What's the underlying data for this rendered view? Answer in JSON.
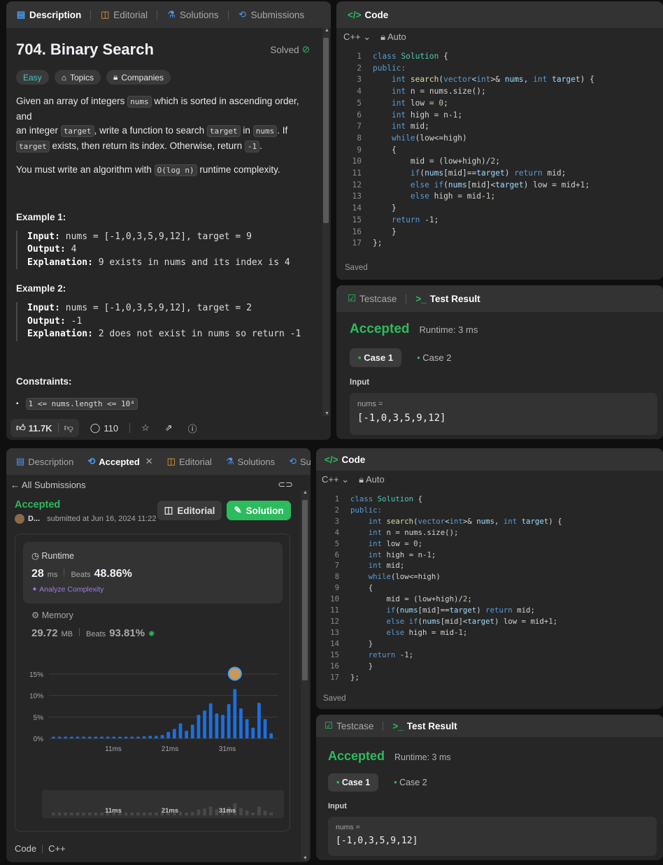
{
  "p1": {
    "tabs": [
      "Description",
      "Editorial",
      "Solutions",
      "Submissions"
    ],
    "title": "704. Binary Search",
    "solved": "Solved",
    "tags": [
      "Easy",
      "Topics",
      "Companies"
    ],
    "desc": {
      "t1": "Given an array of integers",
      "c1": "nums",
      "t2": "which is sorted in ascending order, and",
      "t3": "an integer",
      "c2": "target",
      "t4": ", write a function to search",
      "c3": "target",
      "t5": "in",
      "c4": "nums",
      "t6": ". If",
      "c5": "target",
      "t7": "exists, then return its index. Otherwise, return",
      "c6": "-1",
      "t8": ".",
      "t9": "You must write an algorithm with",
      "c7": "O(log n)",
      "t10": "runtime complexity."
    },
    "ex1": {
      "h": "Example 1:",
      "in_l": "Input:",
      "in_v": "nums = [-1,0,3,5,9,12], target = 9",
      "out_l": "Output:",
      "out_v": "4",
      "ex_l": "Explanation:",
      "ex_v": "9 exists in nums and its index is 4"
    },
    "ex2": {
      "h": "Example 2:",
      "in_l": "Input:",
      "in_v": "nums = [-1,0,3,5,9,12], target = 2",
      "out_l": "Output:",
      "out_v": "-1",
      "ex_l": "Explanation:",
      "ex_v": "2 does not exist in nums so return -1"
    },
    "constraints_h": "Constraints:",
    "constraint1": "1 <= nums.length <= 10⁴",
    "likes": "11.7K",
    "comments": "110"
  },
  "code_panel": {
    "title": "Code",
    "lang": "C++",
    "mode": "Auto",
    "saved": "Saved"
  },
  "result": {
    "tab1": "Testcase",
    "tab2": "Test Result",
    "status": "Accepted",
    "runtime": "Runtime: 3 ms",
    "case1": "Case 1",
    "case2": "Case 2",
    "input_l": "Input",
    "var": "nums =",
    "val": "[-1,0,3,5,9,12]"
  },
  "p3": {
    "tabs": [
      "Description",
      "Accepted",
      "Editorial",
      "Solutions",
      "Submi"
    ],
    "back": "All Submissions",
    "status": "Accepted",
    "user": "D...",
    "submitted": "submitted at Jun 16, 2024 11:22",
    "editorial_btn": "Editorial",
    "solution_btn": "Solution",
    "runtime_l": "Runtime",
    "runtime_v": "28",
    "runtime_u": "ms",
    "beats_l": "Beats",
    "runtime_beats": "48.86%",
    "analyze": "Analyze Complexity",
    "memory_l": "Memory",
    "memory_v": "29.72",
    "memory_u": "MB",
    "memory_beats": "93.81%",
    "footer_code": "Code",
    "footer_lang": "C++"
  },
  "chart_data": {
    "type": "bar",
    "yticks": [
      "15%",
      "10%",
      "5%",
      "0%"
    ],
    "xticks": [
      "11ms",
      "21ms",
      "31ms"
    ],
    "ylim": [
      0,
      15
    ],
    "values": [
      0.4,
      0.4,
      0.4,
      0.4,
      0.4,
      0.4,
      0.4,
      0.4,
      0.4,
      0.4,
      0.4,
      0.4,
      0.4,
      0.4,
      0.4,
      0.5,
      0.6,
      0.6,
      0.8,
      1.5,
      2.2,
      3.5,
      1.8,
      3.2,
      5.5,
      6.5,
      8.2,
      5.8,
      5.5,
      8.0,
      11.5,
      7.0,
      4.5,
      2.5,
      8.3,
      4.5,
      1.2
    ],
    "highlight_index": 30,
    "colors": {
      "bar": "#1b6fe0",
      "bg": "#262626"
    }
  },
  "code_lines": [
    "class Solution {",
    "public:",
    "    int search(vector<int>& nums, int target) {",
    "    int n = nums.size();",
    "    int low = 0;",
    "    int high = n-1;",
    "    int mid;",
    "    while(low<=high)",
    "    {",
    "        mid = (low+high)/2;",
    "        if(nums[mid]==target) return mid;",
    "        else if(nums[mid]<target) low = mid+1;",
    "        else high = mid-1;",
    "    }",
    "    return -1;",
    "    }",
    "};"
  ]
}
